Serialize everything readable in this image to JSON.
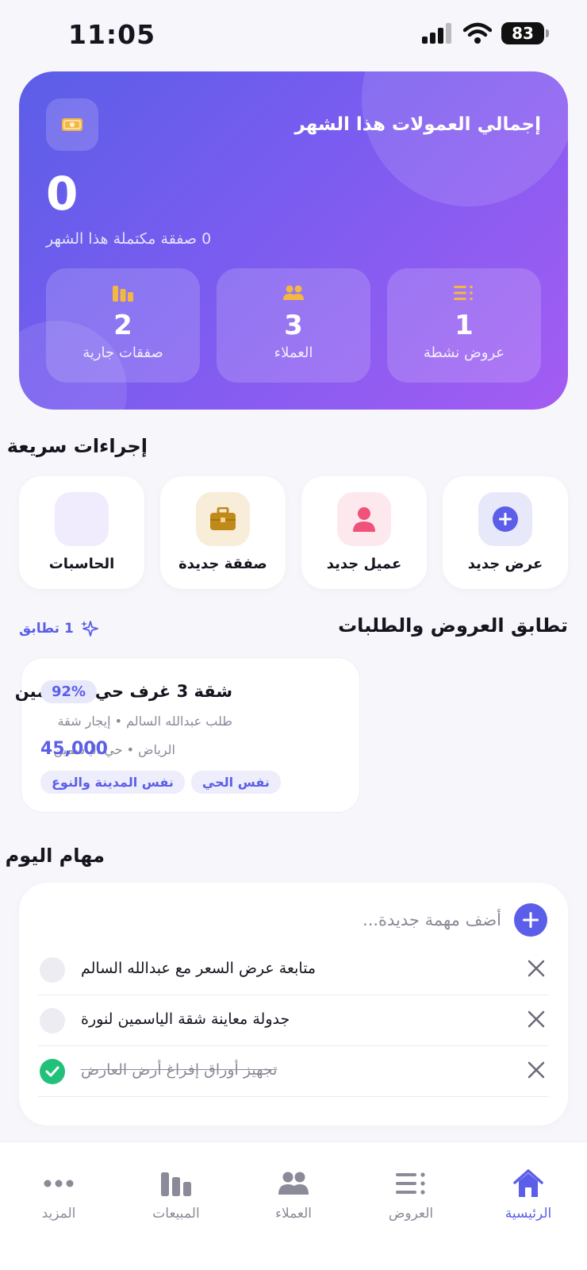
{
  "status": {
    "time": "11:05",
    "battery": "83"
  },
  "hero": {
    "title": "إجمالي العمولات هذا الشهر",
    "amount": "0",
    "subtitle": "0 صفقة مكتملة هذا الشهر",
    "stats": [
      {
        "value": "1",
        "label": "عروض نشطة",
        "icon": "list-icon"
      },
      {
        "value": "3",
        "label": "العملاء",
        "icon": "users-icon"
      },
      {
        "value": "2",
        "label": "صفقات جارية",
        "icon": "chart-icon"
      }
    ]
  },
  "quick_actions": {
    "title": "إجراءات سريعة",
    "items": [
      {
        "label": "عرض جديد",
        "icon": "plus-circle-icon"
      },
      {
        "label": "عميل جديد",
        "icon": "person-icon"
      },
      {
        "label": "صفقة جديدة",
        "icon": "briefcase-icon"
      },
      {
        "label": "الحاسبات",
        "icon": "calculator-icon"
      }
    ]
  },
  "matching": {
    "title": "تطابق العروض والطلبات",
    "count": "1 تطابق",
    "card": {
      "title": "شقة 3 غرف حي الياسمين",
      "percent": "92%",
      "subtitle": "طلب عبدالله السالم • إيجار شقة",
      "location": "الرياض • حي الياسمين",
      "price": "45,000",
      "tags": [
        "نفس المدينة والنوع",
        "نفس الحي"
      ]
    }
  },
  "tasks": {
    "title": "مهام اليوم",
    "placeholder": "أضف مهمة جديدة...",
    "items": [
      {
        "text": "متابعة عرض السعر مع عبدالله السالم",
        "done": false
      },
      {
        "text": "جدولة معاينة شقة الياسمين لنورة",
        "done": false
      },
      {
        "text": "تجهيز أوراق إفراغ أرض العارض",
        "done": true
      }
    ]
  },
  "tabs": [
    {
      "label": "الرئيسية",
      "active": true
    },
    {
      "label": "العروض",
      "active": false
    },
    {
      "label": "العملاء",
      "active": false
    },
    {
      "label": "المبيعات",
      "active": false
    },
    {
      "label": "المزيد",
      "active": false
    }
  ],
  "colors": {
    "accent": "#5b5ee8",
    "gold": "#f4b740",
    "success": "#22c17a"
  }
}
